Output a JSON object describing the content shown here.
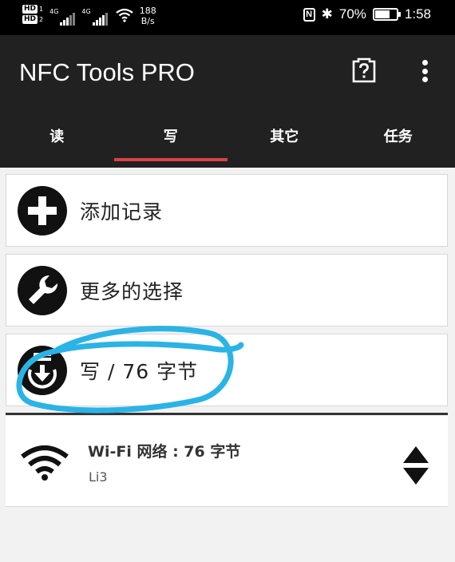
{
  "status_bar": {
    "hd_1": "HD",
    "hd_1_sub": "1",
    "hd_2": "HD",
    "hd_2_sub": "2",
    "network_1": "4G",
    "network_2": "4G",
    "speed_value": "188",
    "speed_unit": "B/s",
    "nfc_badge": "N",
    "bluetooth": "✱",
    "battery": "70%",
    "battery_level": 0.7,
    "time": "1:58"
  },
  "app_bar": {
    "title": "NFC Tools PRO",
    "help_icon": "question-mark-box-icon",
    "menu_icon": "more-vert-icon"
  },
  "tabs": [
    {
      "label": "读",
      "active": false
    },
    {
      "label": "写",
      "active": true
    },
    {
      "label": "其它",
      "active": false
    },
    {
      "label": "任务",
      "active": false
    }
  ],
  "actions": [
    {
      "label": "添加记录",
      "icon": "add-circle-icon"
    },
    {
      "label": "更多的选择",
      "icon": "wrench-circle-icon"
    },
    {
      "label": "写 / 76 字节",
      "icon": "write-tag-icon"
    }
  ],
  "record": {
    "title": "Wi-Fi 网络 : 76 字节",
    "subtitle": "Li3",
    "icon": "wifi-icon",
    "sort_icon": "up-down-arrows-icon"
  },
  "colors": {
    "app_bar": "#212121",
    "tab_indicator": "#d84343",
    "annotation": "#2bb3e6"
  }
}
